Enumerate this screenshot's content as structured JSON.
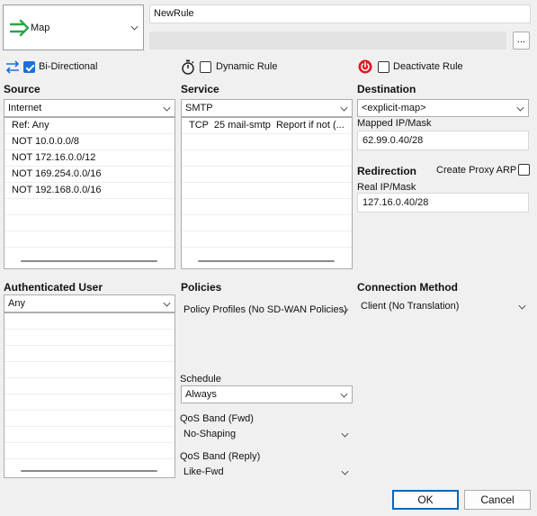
{
  "rule_type": {
    "label": "Map",
    "icon": "map-arrow-icon"
  },
  "rule_name": "NewRule",
  "rule_comment": "",
  "more_button": "...",
  "options": {
    "bidirectional": {
      "label": "Bi-Directional",
      "checked": true
    },
    "dynamic": {
      "label": "Dynamic Rule",
      "checked": false
    },
    "deactivate": {
      "label": "Deactivate Rule",
      "checked": false
    }
  },
  "source": {
    "heading": "Source",
    "selected": "Internet",
    "items": [
      "Ref: Any",
      "NOT 10.0.0.0/8",
      "NOT 172.16.0.0/12",
      "NOT 169.254.0.0/16",
      "NOT 192.168.0.0/16"
    ]
  },
  "service": {
    "heading": "Service",
    "selected": "SMTP",
    "items": [
      "TCP  25 mail-smtp  Report if not (..."
    ]
  },
  "destination": {
    "heading": "Destination",
    "selected": "<explicit-map>",
    "mapped_label": "Mapped IP/Mask",
    "mapped_value": "62.99.0.40/28"
  },
  "redirection": {
    "heading": "Redirection",
    "proxy_arp_label": "Create Proxy ARP",
    "proxy_arp_checked": false,
    "real_label": "Real IP/Mask",
    "real_value": "127.16.0.40/28"
  },
  "auth_user": {
    "heading": "Authenticated User",
    "selected": "Any"
  },
  "policies": {
    "heading": "Policies",
    "selected": "Policy Profiles (No SD-WAN Policies)"
  },
  "schedule": {
    "label": "Schedule",
    "selected": "Always"
  },
  "qos_fwd": {
    "label": "QoS Band (Fwd)",
    "selected": "No-Shaping"
  },
  "qos_reply": {
    "label": "QoS Band (Reply)",
    "selected": "Like-Fwd"
  },
  "connection": {
    "heading": "Connection Method",
    "selected": "Client (No Translation)"
  },
  "buttons": {
    "ok": "OK",
    "cancel": "Cancel"
  },
  "colors": {
    "accent": "#1e6fd6",
    "map_green": "#2aa64a",
    "deactivate_red": "#e0191f"
  }
}
